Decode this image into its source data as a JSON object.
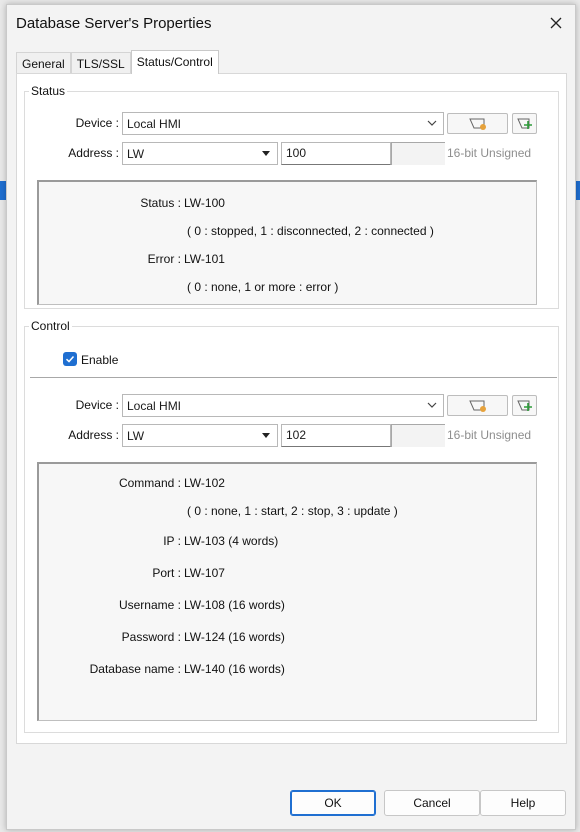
{
  "window": {
    "title": "Database Server's Properties"
  },
  "tabs": [
    {
      "label": "General"
    },
    {
      "label": "TLS/SSL"
    },
    {
      "label": "Status/Control"
    }
  ],
  "status_group": {
    "title": "Status",
    "device_label": "Device :",
    "device_value": "Local HMI",
    "address_label": "Address :",
    "address_type": "LW",
    "address_value": "100",
    "format_hint": "16-bit Unsigned",
    "info": {
      "status_label": "Status :",
      "status_value": "LW-100",
      "status_desc": "( 0 : stopped, 1 : disconnected, 2 : connected )",
      "error_label": "Error :",
      "error_value": "LW-101",
      "error_desc": "( 0 : none, 1 or more : error )"
    }
  },
  "control_group": {
    "title": "Control",
    "enable_label": "Enable",
    "enable_checked": true,
    "device_label": "Device :",
    "device_value": "Local HMI",
    "address_label": "Address :",
    "address_type": "LW",
    "address_value": "102",
    "format_hint": "16-bit Unsigned",
    "info": {
      "command_label": "Command :",
      "command_value": "LW-102",
      "command_desc": "( 0 : none, 1 : start, 2 : stop, 3 : update )",
      "ip_label": "IP :",
      "ip_value": "LW-103 (4 words)",
      "port_label": "Port :",
      "port_value": "LW-107",
      "username_label": "Username :",
      "username_value": "LW-108 (16 words)",
      "password_label": "Password :",
      "password_value": "LW-124 (16 words)",
      "dbname_label": "Database name :",
      "dbname_value": "LW-140 (16 words)"
    }
  },
  "buttons": {
    "ok": "OK",
    "cancel": "Cancel",
    "help": "Help"
  },
  "colors": {
    "accent": "#1f6fd1",
    "hint_text": "#8e8e8e"
  },
  "icons": [
    "close-icon",
    "dropdown-arrow-icon",
    "address-book-icon",
    "add-address-icon",
    "checkmark-icon"
  ]
}
